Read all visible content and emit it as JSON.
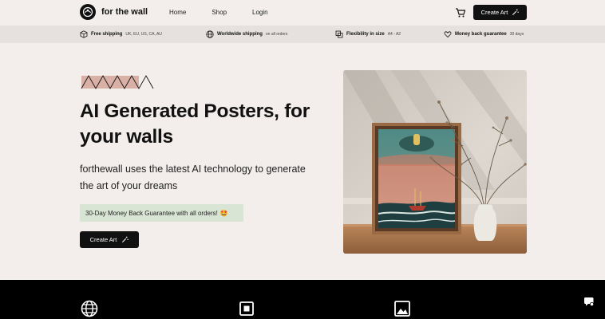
{
  "brand": {
    "name": "for the wall"
  },
  "nav": {
    "home": "Home",
    "shop": "Shop",
    "login": "Login"
  },
  "header": {
    "create_label": "Create Art"
  },
  "infobar": [
    {
      "icon": "box-icon",
      "title": "Free shipping",
      "sub": "UK, EU, US, CA, AU"
    },
    {
      "icon": "globe-icon",
      "title": "Worldwide shipping",
      "sub": "on all orders"
    },
    {
      "icon": "resize-icon",
      "title": "Flexibility in size",
      "sub": "A4 - A2"
    },
    {
      "icon": "heart-hand-icon",
      "title": "Money back guarantee",
      "sub": "30 days"
    }
  ],
  "hero": {
    "title": "AI Generated Posters, for your walls",
    "subtitle": "forthewall uses the latest AI technology to generate the art of your dreams",
    "guarantee": "30-Day Money Back Guarantee with all orders!",
    "guarantee_emoji": "🤩",
    "cta": "Create Art"
  },
  "colors": {
    "accent_dark": "#111111",
    "background": "#f3eeec",
    "infobar": "#e6e1df",
    "guarantee_bg": "#d9e5d4",
    "deco_pink": "#d9b0a6"
  }
}
